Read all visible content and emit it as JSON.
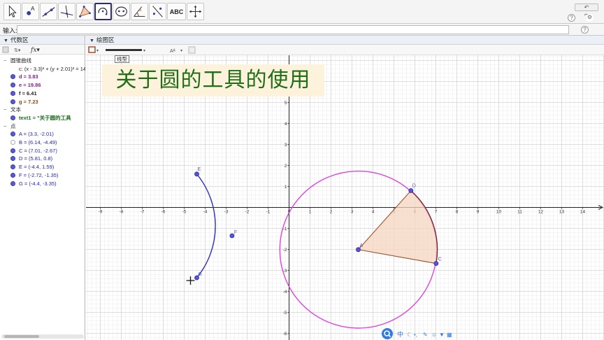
{
  "toolbar": {
    "tools": [
      {
        "name": "move-tool",
        "icon": "arrow-pointer-icon"
      },
      {
        "name": "point-tool",
        "icon": "point-icon",
        "label": "A"
      },
      {
        "name": "line-tool",
        "icon": "line-icon"
      },
      {
        "name": "perpendicular-tool",
        "icon": "perpendicular-icon"
      },
      {
        "name": "polygon-tool",
        "icon": "polygon-icon"
      },
      {
        "name": "circle-tool",
        "icon": "circle-arc-icon",
        "active": true
      },
      {
        "name": "conic-tool",
        "icon": "ellipse-icon"
      },
      {
        "name": "angle-tool",
        "icon": "angle-icon"
      },
      {
        "name": "reflect-tool",
        "icon": "reflect-icon"
      },
      {
        "name": "text-tool",
        "icon": "text-icon",
        "label": "ABC"
      },
      {
        "name": "move-view-tool",
        "icon": "move-view-icon"
      }
    ],
    "undo_label": "↶",
    "redo_label": "↷",
    "help_label": "?",
    "settings_label": "⚙"
  },
  "input_bar": {
    "label": "输入:",
    "help_label": "?"
  },
  "algebra": {
    "title": "代数区",
    "groups": [
      {
        "heading": "圆锥曲线",
        "items": [
          {
            "text": "c: (x - 3.3)² + (y + 2.01)² = 14",
            "style": "c-black",
            "dot": "none"
          }
        ]
      },
      {
        "heading": "",
        "items": [
          {
            "text": "d = 3.83",
            "style": "c-purple",
            "dot": "filled"
          },
          {
            "text": "e = 19.86",
            "style": "c-purple",
            "dot": "filled"
          },
          {
            "text": "f = 6.41",
            "style": "c-dark",
            "dot": "filled"
          },
          {
            "text": "g = 7.23",
            "style": "c-brown",
            "dot": "filled"
          }
        ]
      },
      {
        "heading": "文本",
        "items": [
          {
            "text": "text1 = \"关于圆的工具",
            "style": "c-green",
            "dot": "filled"
          }
        ]
      },
      {
        "heading": "点",
        "items": [
          {
            "text": "A = (3.3, -2.01)",
            "style": "c-blue",
            "dot": "filled"
          },
          {
            "text": "B = (6.14, -4.49)",
            "style": "c-blue",
            "dot": "hollow"
          },
          {
            "text": "C = (7.01, -2.67)",
            "style": "c-blue",
            "dot": "filled"
          },
          {
            "text": "D = (5.81, 0.8)",
            "style": "c-blue",
            "dot": "filled"
          },
          {
            "text": "E = (-4.4, 1.59)",
            "style": "c-blue",
            "dot": "filled"
          },
          {
            "text": "F = (-2.72, -1.35)",
            "style": "c-blue",
            "dot": "filled"
          },
          {
            "text": "G = (-4.4, -3.35)",
            "style": "c-blue",
            "dot": "filled"
          }
        ]
      }
    ]
  },
  "graphics": {
    "title": "绘图区",
    "tooltip": "线型",
    "font_size_label": "Aᴬ",
    "text_title": "关于圆的工具的使用",
    "x_ticks": [
      -9,
      -8,
      -7,
      -6,
      -5,
      -4,
      -3,
      -2,
      -1,
      0,
      1,
      2,
      3,
      4,
      5,
      6,
      7,
      8,
      9,
      10,
      11,
      12,
      13,
      14
    ],
    "y_ticks": [
      5,
      4,
      3,
      2,
      1,
      -1,
      -2,
      -3,
      -4,
      -5,
      -6
    ],
    "points": {
      "A": {
        "label": "A",
        "x": 3.3,
        "y": -2.01,
        "visible": true
      },
      "C": {
        "label": "C",
        "x": 7.01,
        "y": -2.67,
        "visible": true
      },
      "D": {
        "label": "D",
        "x": 5.81,
        "y": 0.8,
        "visible": true
      },
      "E": {
        "label": "E",
        "x": -4.4,
        "y": 1.59,
        "visible": true
      },
      "F": {
        "label": "F",
        "x": -2.72,
        "y": -1.35,
        "visible": true
      },
      "G": {
        "label": "G",
        "x": -4.4,
        "y": -3.35,
        "visible": true
      }
    },
    "circle": {
      "cx": 3.3,
      "cy": -2.01,
      "r": 3.74
    },
    "colors": {
      "circle": "#dd44dd",
      "arc": "#3333bb",
      "sector_fill": "#f4d6c0",
      "sector_stroke": "#a0522d",
      "sector_arc": "#7a2a3a",
      "point": "#5555dd",
      "grid_minor": "#ececec",
      "grid_major": "#d6d6d6",
      "axis": "#222222",
      "title_text": "#1e6f16",
      "title_bg": "#fdf2dc"
    }
  },
  "taskbar": {
    "icons": [
      "search-icon",
      "ime-chinese-icon",
      "moon-icon",
      "punctuation-icon",
      "wrench-icon",
      "emoji-icon",
      "shirt-icon",
      "grid-icon"
    ],
    "ime_label": "中"
  }
}
